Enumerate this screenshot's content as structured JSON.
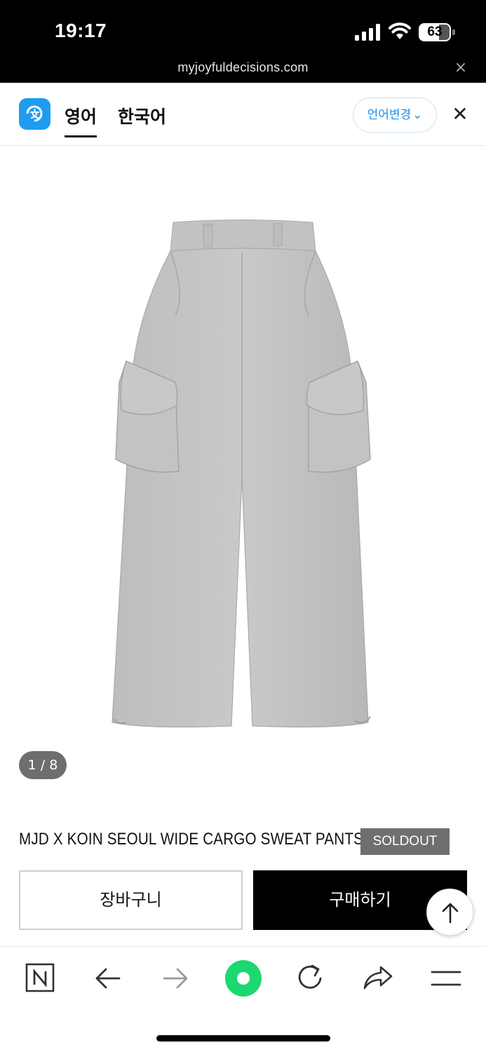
{
  "status_bar": {
    "time": "19:17",
    "battery": "63",
    "battery_level": 0.63
  },
  "browser": {
    "url": "myjoyfuldecisions.com",
    "close_glyph": "×"
  },
  "translate_bar": {
    "logo_icon": "translate-logo-icon",
    "tabs": [
      {
        "label": "영어",
        "active": true
      },
      {
        "label": "한국어",
        "active": false
      }
    ],
    "change_language": "언어변경",
    "chevron_glyph": "⌄",
    "close_glyph": "✕",
    "accent": "#1f9cf0"
  },
  "product": {
    "image_icon": "gray-cargo-sweatpants-image",
    "counter": "1 / 8",
    "title": "MJD X KOIN SEOUL WIDE CARGO SWEAT PANTS",
    "badge": "SOLDOUT"
  },
  "actions": {
    "cart": "장바구니",
    "buy": "구매하기",
    "top_icon": "arrow-up-icon"
  },
  "nav": [
    {
      "name": "naver-n-icon"
    },
    {
      "name": "back-arrow-icon"
    },
    {
      "name": "forward-arrow-icon"
    },
    {
      "name": "green-dot-icon"
    },
    {
      "name": "reload-icon"
    },
    {
      "name": "share-icon"
    },
    {
      "name": "menu-icon"
    }
  ]
}
